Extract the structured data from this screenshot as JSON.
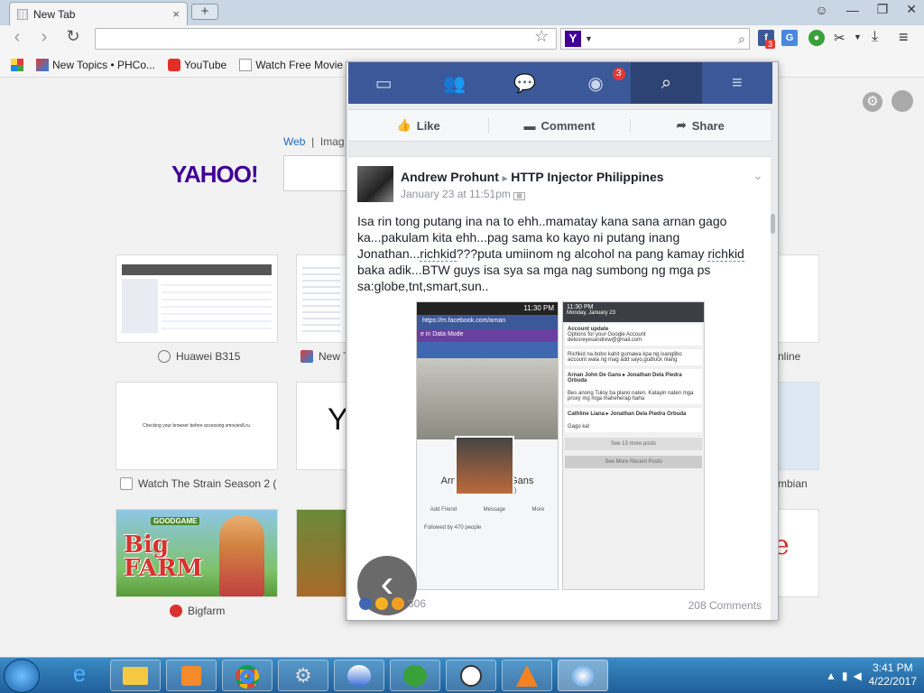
{
  "browser": {
    "tab_title": "New Tab",
    "tab_close": "×",
    "new_tab": "+",
    "window_buttons": [
      "☺",
      "—",
      "❐",
      "✕"
    ],
    "search_engine_label": "Y",
    "fb_ext_badge": "3",
    "bookmarks": [
      "New Topics • PHCo...",
      "YouTube",
      "Watch Free Movie"
    ]
  },
  "newtab_page": {
    "search_tabs": [
      "Web",
      "Imag"
    ],
    "logo": "YAHOO!",
    "tiles": [
      {
        "label": "Huawei B315"
      },
      {
        "label": "New T"
      },
      {
        "label": "nline"
      },
      {
        "label": "Watch The Strain Season 2 ("
      },
      {
        "label": ""
      },
      {
        "label": "mbian"
      },
      {
        "label": "Bigfarm"
      }
    ],
    "tile_texts": {
      "checking": "Checking your browser before accessing smovies8.ru.",
      "yo": "Yo",
      "bigfarm_top": "GOODGAME",
      "bigfarm_main": "Big FARM"
    }
  },
  "facebook": {
    "nav_badge": "3",
    "actions": {
      "like": "Like",
      "comment": "Comment",
      "share": "Share"
    },
    "post": {
      "author": "Andrew Prohunt",
      "arrow": "▸",
      "group": "HTTP Injector Philippines",
      "time": "January 23 at 11:51pm",
      "text_1": "Isa rin tong putang ina na to ehh..mamatay kana sana arnan gago ka...pakulam kita ehh...pag sama ko kayo ni putang inang Jonathan...",
      "tag_1": "richkid",
      "text_2": "???puta umiinom ng alcohol na pang kamay ",
      "tag_2": "richkid",
      "text_3": " baka adik...BTW guys isa sya sa mga nag sumbong ng mga ps sa:globe,tnt,smart,sun..",
      "reaction_count": "306",
      "comment_count": "208 Comments"
    },
    "screenshot_left": {
      "time": "11:30 PM",
      "url": "https://m.facebook.com/arnan",
      "mode": "e in Data Mode",
      "name": "Arnan John De Gans",
      "nick": "(Mr Gans NoFear)",
      "buttons": [
        "Add Friend",
        "Message",
        "More"
      ],
      "followers": "Followed by 470 people"
    },
    "screenshot_right": {
      "time": "11:30 PM",
      "date": "Monday, January 23",
      "notif_title": "Account update",
      "notif_sub": "Options for your Google Account",
      "notif_email": "delosreyesandrew@gmail.com",
      "c1": "Richkid na bobo kahit gumawa kpa ng isanglibo account wala ng mag add sayo,gudluck nlang",
      "c2_name": "Arnan John De Gans ▸ Jonathan Dela Piedra Orbuda",
      "c2": "Bes anong Tuloy ba plano naten. Katayin naten mga proxy mg mga maheherap haha",
      "c3_name": "Cathline Liana ▸ Jonathan Dela Piedra Orbuda",
      "c3": "Gago ka!",
      "see_more": "See 13 more posts",
      "recent": "See More Recent Posts"
    }
  },
  "taskbar": {
    "time": "3:41 PM",
    "date": "4/22/2017"
  }
}
